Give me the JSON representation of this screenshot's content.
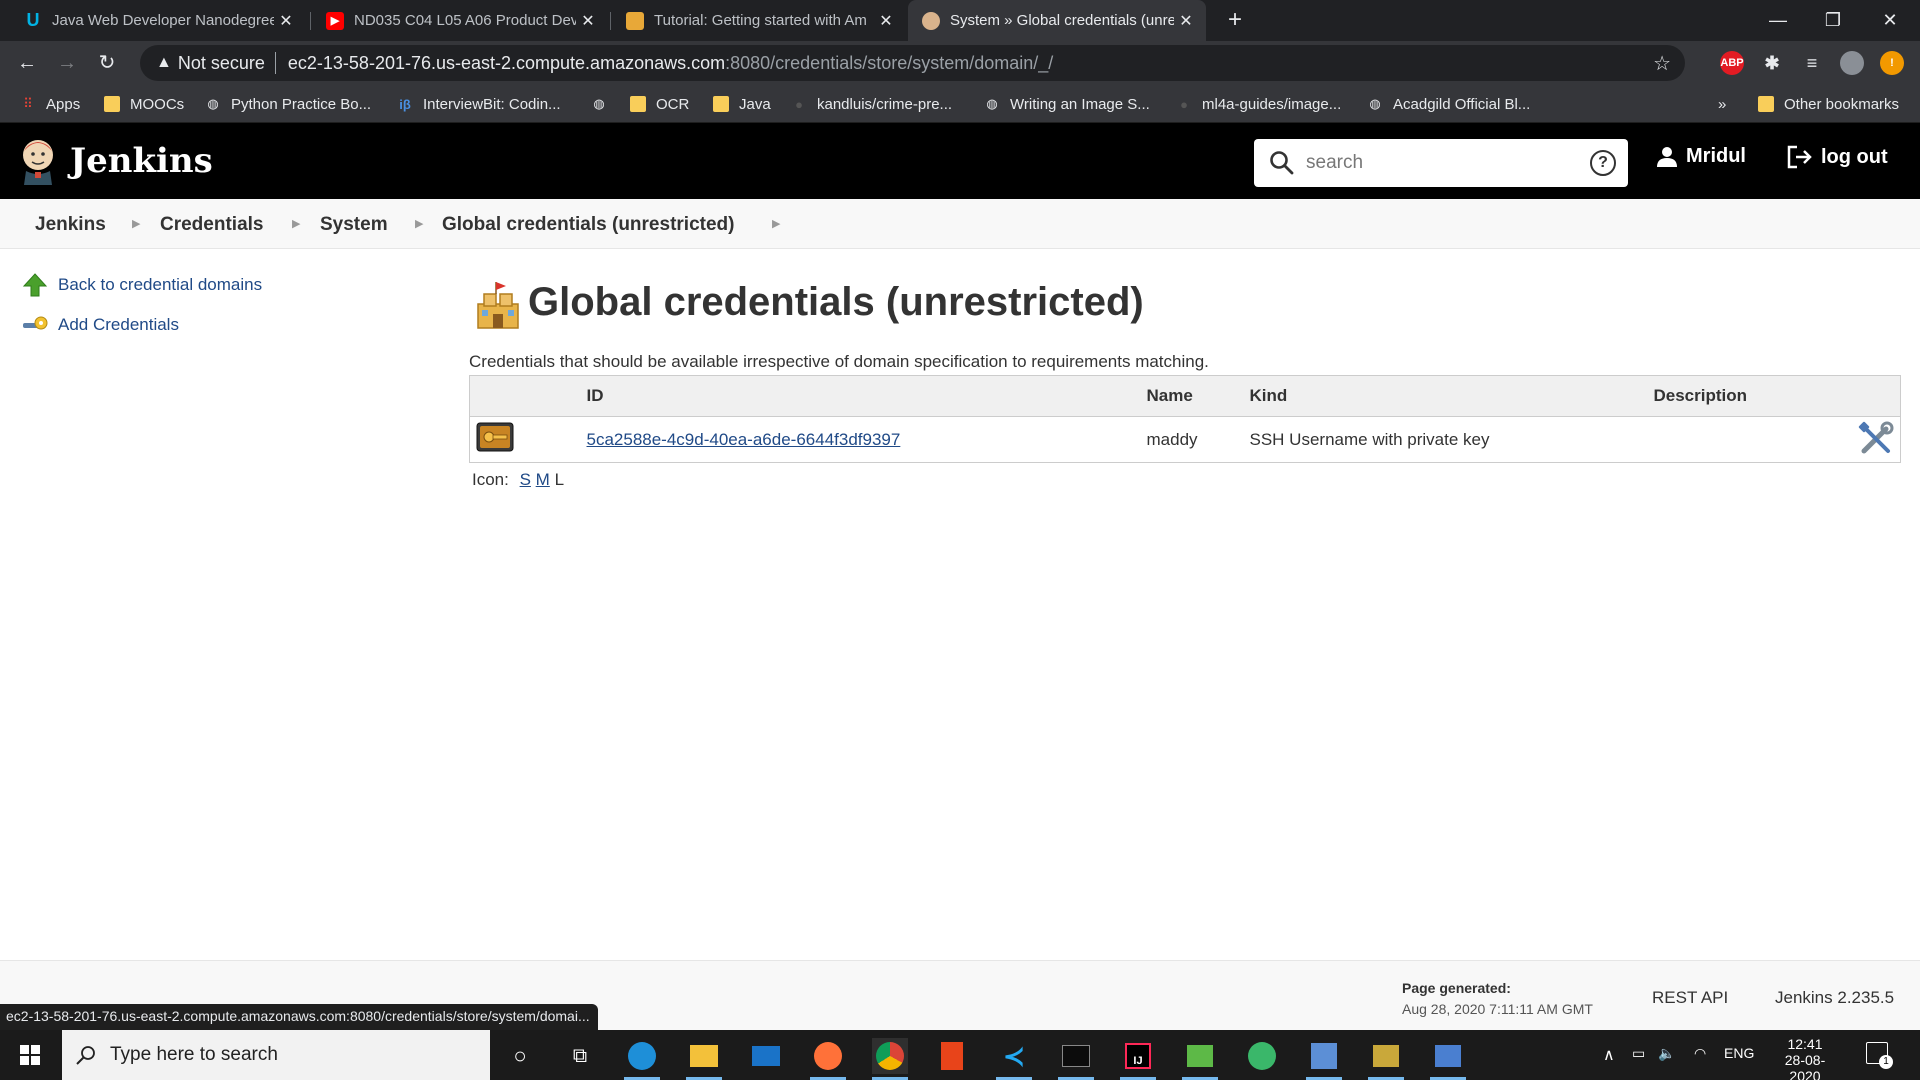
{
  "browser": {
    "tabs": [
      {
        "title": "Java Web Developer Nanodegree",
        "favicon": "udacity-icon",
        "active": false
      },
      {
        "title": "ND035 C04 L05 A06 Product Dev",
        "favicon": "youtube-icon",
        "active": false
      },
      {
        "title": "Tutorial: Getting started with Am",
        "favicon": "aws-box-icon",
        "active": false
      },
      {
        "title": "System » Global credentials (unre",
        "favicon": "jenkins-icon",
        "active": true
      }
    ],
    "address": {
      "security_label": "Not secure",
      "host": "ec2-13-58-201-76.us-east-2.compute.amazonaws.com",
      "path": ":8080/credentials/store/system/domain/_/"
    },
    "bookmarks": [
      {
        "label": "Apps",
        "icon": "apps-grid-icon"
      },
      {
        "label": "MOOCs",
        "icon": "folder-icon"
      },
      {
        "label": "Python Practice Bo...",
        "icon": "globe-icon"
      },
      {
        "label": "InterviewBit: Codin...",
        "icon": "interviewbit-icon"
      },
      {
        "label": "",
        "icon": "globe-icon"
      },
      {
        "label": "OCR",
        "icon": "folder-icon"
      },
      {
        "label": "Java",
        "icon": "folder-icon"
      },
      {
        "label": "kandluis/crime-pre...",
        "icon": "github-icon"
      },
      {
        "label": "Writing an Image S...",
        "icon": "globe-icon"
      },
      {
        "label": "ml4a-guides/image...",
        "icon": "github-icon"
      },
      {
        "label": "Acadgild Official Bl...",
        "icon": "globe-icon"
      }
    ],
    "overflow_label": "»",
    "other_bookmarks_label": "Other bookmarks",
    "status_url": "ec2-13-58-201-76.us-east-2.compute.amazonaws.com:8080/credentials/store/system/domai..."
  },
  "jenkins": {
    "brand": "Jenkins",
    "search_placeholder": "search",
    "help_label": "?",
    "user": "Mridul",
    "logout": "log out",
    "breadcrumb": [
      "Jenkins",
      "Credentials",
      "System",
      "Global credentials (unrestricted)"
    ],
    "side_panel": [
      {
        "label": "Back to credential domains",
        "icon": "up-arrow-icon"
      },
      {
        "label": "Add Credentials",
        "icon": "key-icon"
      }
    ],
    "page_title": "Global credentials (unrestricted)",
    "description": "Credentials that should be available irrespective of domain specification to requirements matching.",
    "table": {
      "headers": [
        "ID",
        "Name",
        "Kind",
        "Description"
      ],
      "rows": [
        {
          "id": "5ca2588e-4c9d-40ea-a6de-6644f3df9397",
          "name": "maddy",
          "kind": "SSH Username with private key",
          "description": ""
        }
      ]
    },
    "icon_size": {
      "label": "Icon:",
      "options": [
        "S",
        "M",
        "L"
      ],
      "selected": "L"
    },
    "footer": {
      "page_generated_label": "Page generated:",
      "page_generated_date": "Aug 28, 2020 7:11:11 AM GMT",
      "rest_api": "REST API",
      "version": "Jenkins 2.235.5"
    }
  },
  "taskbar": {
    "search_placeholder": "Type here to search",
    "language": "ENG",
    "time": "12:41",
    "date": "28-08-2020",
    "notification_count": "1"
  }
}
